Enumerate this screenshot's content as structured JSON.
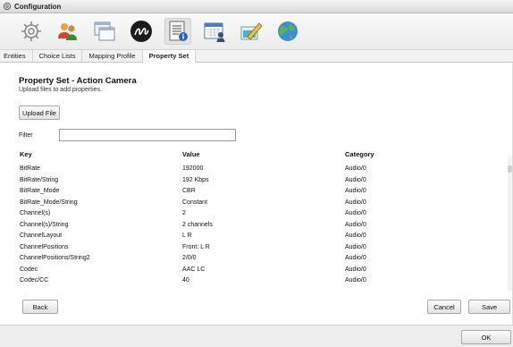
{
  "window": {
    "title": "Configuration"
  },
  "toolbar": {
    "icons": [
      {
        "name": "gear-icon"
      },
      {
        "name": "users-icon"
      },
      {
        "name": "windows-icon"
      },
      {
        "name": "logo-icon"
      },
      {
        "name": "property-document-icon"
      },
      {
        "name": "calendar-user-icon"
      },
      {
        "name": "pencil-icon"
      },
      {
        "name": "globe-icon"
      }
    ],
    "active_index": 4
  },
  "tabs": [
    {
      "label": "Entities"
    },
    {
      "label": "Choice Lists"
    },
    {
      "label": "Mapping Profile"
    },
    {
      "label": "Property Set",
      "active": true
    }
  ],
  "page": {
    "title": "Property Set - Action Camera",
    "subtitle": "Upload files to add properties.",
    "upload_label": "Upload File",
    "filter_label": "Filter",
    "filter_value": ""
  },
  "table": {
    "headers": {
      "key": "Key",
      "value": "Value",
      "category": "Category"
    },
    "rows": [
      {
        "key": "BitRate",
        "value": "192000",
        "category": "Audio/0"
      },
      {
        "key": "BitRate/String",
        "value": "192 Kbps",
        "category": "Audio/0"
      },
      {
        "key": "BitRate_Mode",
        "value": "CBR",
        "category": "Audio/0"
      },
      {
        "key": "BitRate_Mode/String",
        "value": "Constant",
        "category": "Audio/0"
      },
      {
        "key": "Channel(s)",
        "value": "2",
        "category": "Audio/0"
      },
      {
        "key": "Channel(s)/String",
        "value": "2 channels",
        "category": "Audio/0"
      },
      {
        "key": "ChannelLayout",
        "value": "L R",
        "category": "Audio/0"
      },
      {
        "key": "ChannelPositions",
        "value": "Front: L R",
        "category": "Audio/0"
      },
      {
        "key": "ChannelPositions/String2",
        "value": "2/0/0",
        "category": "Audio/0"
      },
      {
        "key": "Codec",
        "value": "AAC LC",
        "category": "Audio/0"
      },
      {
        "key": "Codec/CC",
        "value": "40",
        "category": "Audio/0"
      }
    ]
  },
  "actions": {
    "back": "Back",
    "cancel": "Cancel",
    "save": "Save"
  },
  "footer": {
    "ok": "OK"
  }
}
